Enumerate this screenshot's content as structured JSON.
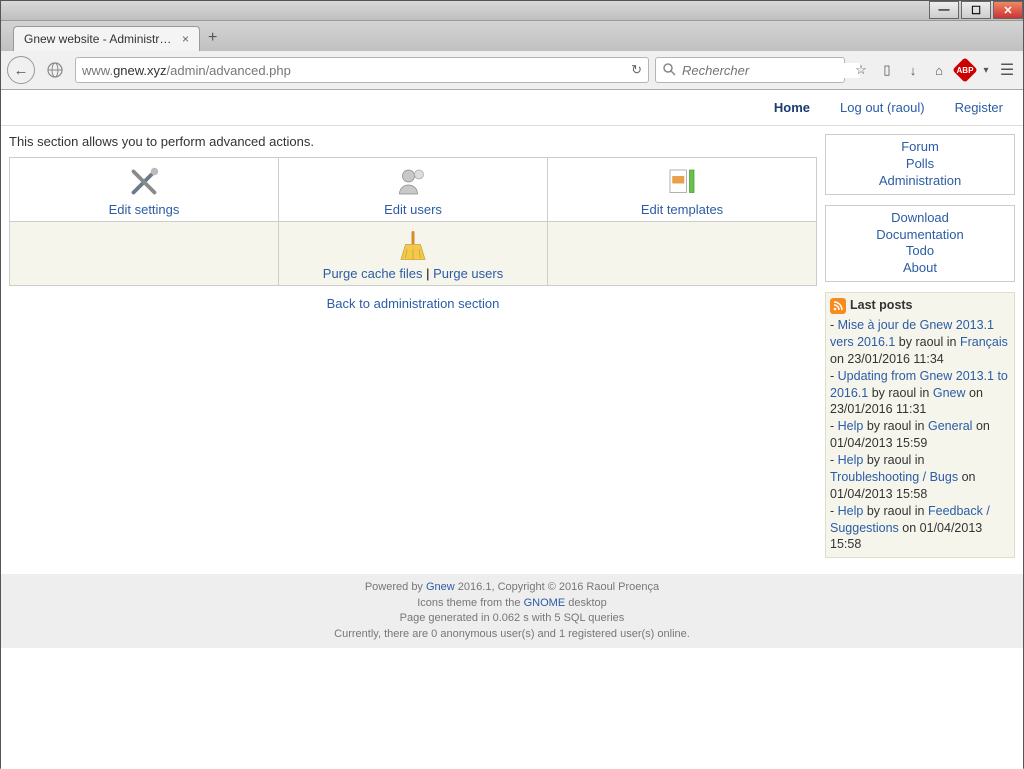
{
  "window": {
    "tab_title": "Gnew website - Administration...",
    "url_prefix": "www.",
    "url_domain": "gnew.xyz",
    "url_path": "/admin/advanced.php",
    "search_placeholder": "Rechercher"
  },
  "topnav": {
    "home": "Home",
    "logout": "Log out (raoul)",
    "register": "Register"
  },
  "main": {
    "section_text": "This section allows you to perform advanced actions.",
    "edit_settings": "Edit settings",
    "edit_users": "Edit users",
    "edit_templates": "Edit templates",
    "purge_cache": "Purge cache files",
    "purge_users": "Purge users",
    "separator": " | ",
    "back_link": "Back to administration section"
  },
  "sidebar": {
    "box1": {
      "forum": "Forum",
      "polls": "Polls",
      "admin": "Administration"
    },
    "box2": {
      "download": "Download",
      "docs": "Documentation",
      "todo": "Todo",
      "about": "About"
    }
  },
  "posts": {
    "header": "Last posts",
    "items": [
      {
        "title": "Mise à jour de Gnew 2013.1 vers 2016.1",
        "by": " by raoul in ",
        "cat": "Français",
        "date": " on 23/01/2016 11:34"
      },
      {
        "title": "Updating from Gnew 2013.1 to 2016.1",
        "by": " by raoul in ",
        "cat": "Gnew",
        "date": " on 23/01/2016 11:31"
      },
      {
        "title": "Help",
        "by": " by raoul in ",
        "cat": "General",
        "date": " on 01/04/2013 15:59"
      },
      {
        "title": "Help",
        "by": " by raoul in ",
        "cat": "Troubleshooting / Bugs",
        "date": " on 01/04/2013 15:58"
      },
      {
        "title": "Help",
        "by": " by raoul in ",
        "cat": "Feedback / Suggestions",
        "date": " on 01/04/2013 15:58"
      }
    ]
  },
  "footer": {
    "l1a": "Powered by ",
    "l1link": "Gnew",
    "l1b": " 2016.1, Copyright © 2016 Raoul Proença",
    "l2a": "Icons theme from the ",
    "l2link": "GNOME",
    "l2b": " desktop",
    "l3": "Page generated in 0.062 s with 5 SQL queries",
    "l4": "Currently, there are 0 anonymous user(s) and 1 registered user(s) online."
  }
}
